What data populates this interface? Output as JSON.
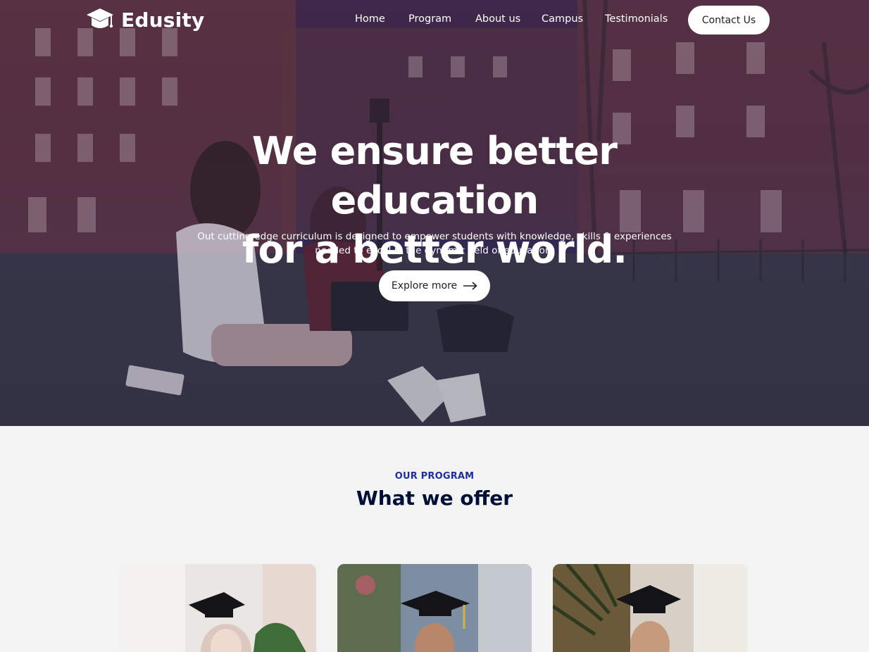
{
  "brand": {
    "name": "Edusity"
  },
  "nav": {
    "links": [
      {
        "label": "Home"
      },
      {
        "label": "Program"
      },
      {
        "label": "About us"
      },
      {
        "label": "Campus"
      },
      {
        "label": "Testimonials"
      }
    ],
    "contact_label": "Contact Us"
  },
  "hero": {
    "title_line1": "We ensure better education",
    "title_line2": "for a better world.",
    "subtitle_line1": "Out cutting-edge curriculum is designed to empower students with knowledge, skills & experiences",
    "subtitle_line2": "needed to excel in the dynamic field of education.",
    "cta_label": "Explore more"
  },
  "program": {
    "eyebrow": "OUR PROGRAM",
    "title": "What we offer"
  },
  "colors": {
    "overlay": "#261c54",
    "accent": "#212ea0",
    "heading": "#000f38",
    "section_bg": "#f3f3f3"
  },
  "icons": {
    "logo": "graduation-cap-icon",
    "cta": "arrow-right-icon"
  }
}
